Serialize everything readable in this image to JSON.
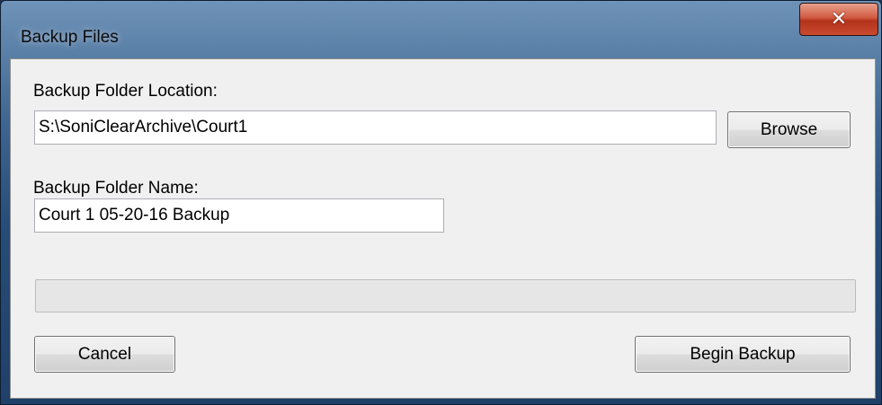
{
  "window": {
    "title": "Backup Files",
    "close_glyph": "✕"
  },
  "form": {
    "location_label": "Backup Folder Location:",
    "location_value": "S:\\SoniClearArchive\\Court1",
    "browse_label": "Browse",
    "name_label": "Backup Folder Name:",
    "name_value": "Court 1 05-20-16 Backup"
  },
  "progress": {
    "value": 0
  },
  "actions": {
    "cancel_label": "Cancel",
    "begin_label": "Begin Backup"
  }
}
